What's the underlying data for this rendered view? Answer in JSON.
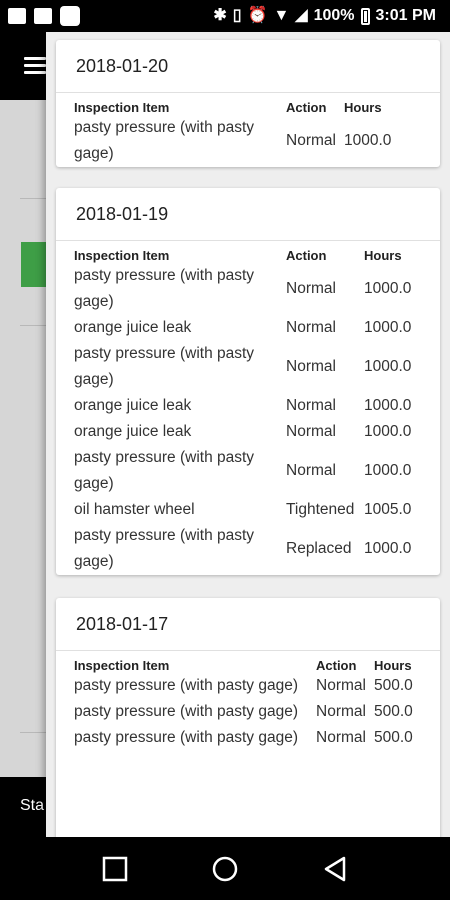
{
  "status_bar": {
    "battery_percent": "100%",
    "time": "3:01 PM",
    "icons": [
      "image-icon",
      "message-icon",
      "app-icon",
      "bluetooth-icon",
      "vibrate-icon",
      "alarm-icon",
      "wifi-icon",
      "signal-icon",
      "battery-icon"
    ]
  },
  "background": {
    "bottom_text": "Sta"
  },
  "cards": [
    {
      "date": "2018-01-20",
      "headers": {
        "item": "Inspection Item",
        "action": "Action",
        "hours": "Hours"
      },
      "rows": [
        {
          "item": "pasty pressure (with pasty gage)",
          "action": "Normal",
          "hours": "1000.0"
        }
      ]
    },
    {
      "date": "2018-01-19",
      "headers": {
        "item": "Inspection Item",
        "action": "Action",
        "hours": "Hours"
      },
      "rows": [
        {
          "item": "pasty pressure (with pasty gage)",
          "action": "Normal",
          "hours": "1000.0"
        },
        {
          "item": "orange juice leak",
          "action": "Normal",
          "hours": "1000.0"
        },
        {
          "item": "pasty pressure (with pasty gage)",
          "action": "Normal",
          "hours": "1000.0"
        },
        {
          "item": "orange juice leak",
          "action": "Normal",
          "hours": "1000.0"
        },
        {
          "item": "orange juice leak",
          "action": "Normal",
          "hours": "1000.0"
        },
        {
          "item": "pasty pressure (with pasty gage)",
          "action": "Normal",
          "hours": "1000.0"
        },
        {
          "item": "oil hamster wheel",
          "action": "Tightened",
          "hours": "1005.0"
        },
        {
          "item": "pasty pressure (with pasty gage)",
          "action": "Replaced",
          "hours": "1000.0"
        }
      ]
    },
    {
      "date": "2018-01-17",
      "headers": {
        "item": "Inspection Item",
        "action": "Action",
        "hours": "Hours"
      },
      "rows": [
        {
          "item": "pasty pressure (with pasty gage)",
          "action": "Normal",
          "hours": "500.0"
        },
        {
          "item": "pasty pressure (with pasty gage)",
          "action": "Normal",
          "hours": "500.0"
        },
        {
          "item": "pasty pressure (with pasty gage)",
          "action": "Normal",
          "hours": "500.0"
        }
      ]
    }
  ],
  "nav": [
    "recents-button",
    "home-button",
    "back-button"
  ]
}
